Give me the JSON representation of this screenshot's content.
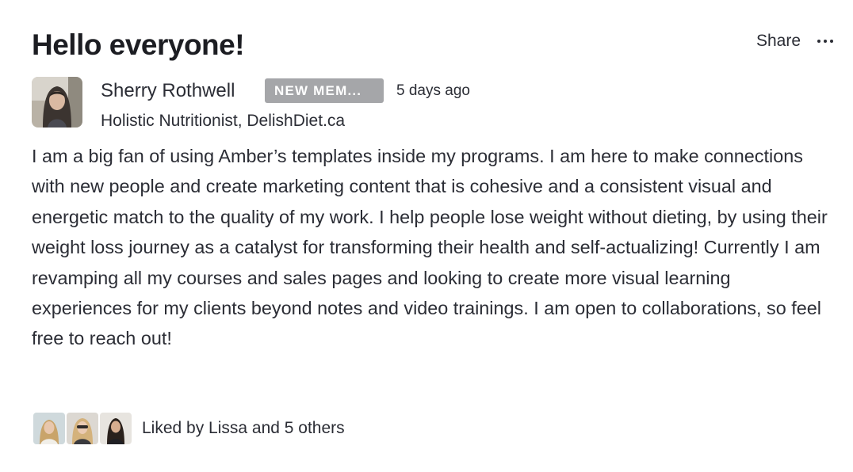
{
  "post": {
    "title": "Hello everyone!",
    "share_label": "Share",
    "more_icon": "ellipsis-horizontal-icon",
    "author": {
      "name": "Sherry Rothwell",
      "badge": "NEW MEM...",
      "timestamp": "5 days ago",
      "headline": "Holistic Nutritionist, DelishDiet.ca"
    },
    "body": "I am a big fan of using Amber’s templates inside my programs. I am here to make connections with new people and create marketing content that is cohesive and a consistent visual and energetic match to the quality of my work. I help people lose weight without dieting, by using their weight loss journey as a catalyst for transforming their health and self-actualizing! Currently I am revamping all my courses and sales pages and looking to create more visual learning experiences for my clients beyond notes and video trainings. I  am open to collaborations, so feel free to reach out!",
    "likes": {
      "text": "Liked by Lissa and 5 others"
    }
  },
  "colors": {
    "text": "#2b2d35",
    "badge_bg": "#a5a6a9",
    "background": "#ffffff"
  }
}
